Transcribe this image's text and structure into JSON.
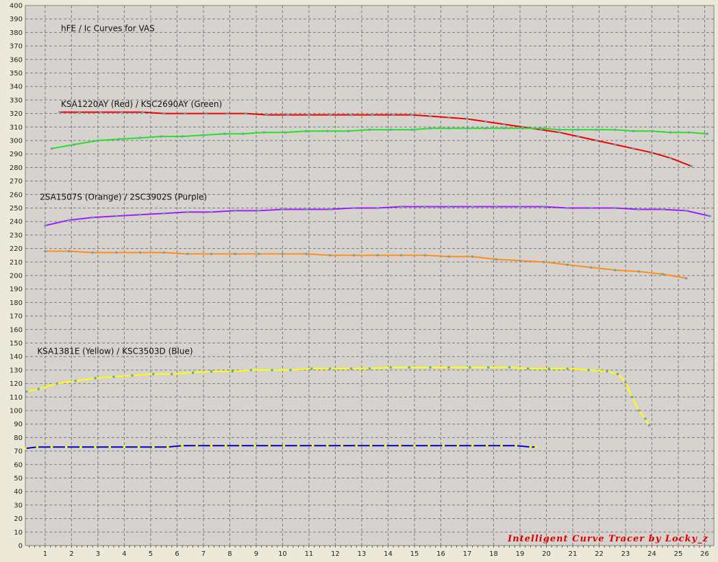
{
  "chart_data": {
    "type": "line",
    "title": "hFE / Ic Curves for VAS",
    "xlabel": "",
    "ylabel": "",
    "xlim": [
      0.25,
      26.35
    ],
    "ylim": [
      0,
      400
    ],
    "x_ticks": [
      1,
      2,
      3,
      4,
      5,
      6,
      7,
      8,
      9,
      10,
      11,
      12,
      13,
      14,
      15,
      16,
      17,
      18,
      19,
      20,
      21,
      22,
      23,
      24,
      25,
      26
    ],
    "x_tick_labels": [
      "1",
      "2",
      "3",
      "4",
      "5",
      "6",
      "7",
      "8",
      "9",
      "10",
      "11",
      "12",
      "13",
      "14",
      "15",
      "16",
      "17",
      "18",
      "19",
      "20",
      "21",
      "22",
      "23",
      "24",
      "25",
      "26"
    ],
    "y_ticks": [
      0,
      10,
      20,
      30,
      40,
      50,
      60,
      70,
      80,
      90,
      100,
      110,
      120,
      130,
      140,
      150,
      160,
      170,
      180,
      190,
      200,
      210,
      220,
      230,
      240,
      250,
      260,
      270,
      280,
      290,
      300,
      310,
      320,
      330,
      340,
      350,
      360,
      370,
      380,
      390,
      400
    ],
    "y_tick_labels": [
      "0",
      "10",
      "20",
      "30",
      "40",
      "50",
      "60",
      "70",
      "80",
      "90",
      "100",
      "110",
      "120",
      "130",
      "140",
      "150",
      "160",
      "170",
      "180",
      "190",
      "200",
      "210",
      "220",
      "230",
      "240",
      "250",
      "260",
      "270",
      "280",
      "290",
      "300",
      "310",
      "320",
      "330",
      "340",
      "350",
      "360",
      "370",
      "380",
      "390",
      "400"
    ],
    "grid": true,
    "annotations": [
      {
        "text": "hFE / Ic Curves for VAS",
        "x": 1.6,
        "y": 381
      },
      {
        "text": "KSA1220AY (Red) / KSC2690AY (Green)",
        "x": 1.6,
        "y": 325
      },
      {
        "text": "2SA1507S (Orange) / 2SC3902S (Purple)",
        "x": 0.8,
        "y": 256
      },
      {
        "text": "KSA1381E (Yellow) / KSC3503D (Blue)",
        "x": 0.7,
        "y": 142
      }
    ],
    "watermark": "Intelligent Curve Tracer by Locky_z",
    "series": [
      {
        "name": "KSA1220AY (Red)",
        "color": "#ee0000",
        "marker_color": "#77a0a8",
        "x": [
          1.55,
          2.3,
          3.1,
          3.9,
          4.7,
          5.5,
          6.3,
          7.1,
          7.9,
          8.6,
          9.4,
          10.2,
          11.0,
          11.8,
          12.6,
          13.4,
          14.2,
          14.9,
          15.6,
          16.3,
          17.0,
          17.7,
          18.4,
          19.1,
          19.8,
          20.5,
          21.2,
          21.9,
          22.6,
          23.3,
          24.0,
          24.7,
          25.5
        ],
        "y": [
          321,
          321,
          321,
          321,
          321,
          320,
          320,
          320,
          320,
          320,
          319,
          319,
          319,
          319,
          319,
          319,
          319,
          319,
          318,
          317,
          316,
          314,
          312,
          310,
          308,
          306,
          303,
          300,
          297,
          294,
          291,
          287,
          281
        ]
      },
      {
        "name": "KSC2690AY (Green)",
        "color": "#22e022",
        "marker_color": "#77a0a8",
        "x": [
          1.25,
          2.1,
          3.0,
          3.8,
          4.6,
          5.4,
          6.2,
          7.0,
          7.8,
          8.5,
          9.3,
          10.1,
          10.9,
          11.7,
          12.5,
          13.3,
          14.1,
          14.9,
          15.6,
          16.3,
          17.0,
          17.7,
          18.4,
          19.1,
          19.8,
          20.5,
          21.2,
          21.9,
          22.6,
          23.3,
          24.0,
          24.7,
          25.4,
          26.1
        ],
        "y": [
          294,
          297,
          300,
          301,
          302,
          303,
          303,
          304,
          305,
          305,
          306,
          306,
          307,
          307,
          307,
          308,
          308,
          308,
          309,
          309,
          309,
          309,
          309,
          309,
          309,
          308,
          308,
          308,
          308,
          307,
          307,
          306,
          306,
          305
        ]
      },
      {
        "name": "2SC3902S (Purple)",
        "color": "#9b1eff",
        "marker_color": "#77a0a8",
        "x": [
          1.0,
          1.9,
          2.8,
          3.7,
          4.6,
          5.5,
          6.4,
          7.3,
          8.2,
          9.1,
          10.0,
          10.9,
          11.8,
          12.7,
          13.6,
          14.5,
          15.4,
          16.3,
          17.2,
          18.1,
          19.0,
          19.9,
          20.8,
          21.7,
          22.6,
          23.5,
          24.4,
          25.3,
          26.2
        ],
        "y": [
          237,
          241,
          243,
          244,
          245,
          246,
          247,
          247,
          248,
          248,
          249,
          249,
          249,
          250,
          250,
          251,
          251,
          251,
          251,
          251,
          251,
          251,
          250,
          250,
          250,
          249,
          249,
          248,
          244
        ]
      },
      {
        "name": "2SA1507S (Orange)",
        "color": "#ff8c1a",
        "marker_color": "#77a0a8",
        "x": [
          1.0,
          1.9,
          2.8,
          3.7,
          4.6,
          5.5,
          6.4,
          7.3,
          8.2,
          9.1,
          10.0,
          10.9,
          11.8,
          12.7,
          13.6,
          14.5,
          15.4,
          16.3,
          17.2,
          18.1,
          19.0,
          19.9,
          20.8,
          21.7,
          22.6,
          23.5,
          24.4,
          25.3
        ],
        "y": [
          218,
          218,
          217,
          217,
          217,
          217,
          216,
          216,
          216,
          216,
          216,
          216,
          215,
          215,
          215,
          215,
          215,
          214,
          214,
          212,
          211,
          210,
          208,
          206,
          204,
          203,
          201,
          198
        ]
      },
      {
        "name": "KSA1381E (Yellow)",
        "color": "#ffff00",
        "marker_color": "#77a0a8",
        "x": [
          0.3,
          0.75,
          1.45,
          2.15,
          2.9,
          3.6,
          4.3,
          5.1,
          5.8,
          6.6,
          7.3,
          8.1,
          8.8,
          9.6,
          10.3,
          11.1,
          11.8,
          12.6,
          13.3,
          14.1,
          14.8,
          15.6,
          16.3,
          17.1,
          17.8,
          18.6,
          19.3,
          20.1,
          20.8,
          21.6,
          22.3,
          22.7,
          23.0,
          23.25,
          23.5,
          23.75,
          23.9
        ],
        "y": [
          114,
          116,
          120,
          122,
          124,
          125,
          126,
          127,
          127,
          128,
          129,
          129,
          130,
          130,
          130,
          131,
          131,
          131,
          131,
          132,
          132,
          132,
          132,
          132,
          132,
          132,
          131,
          131,
          131,
          130,
          129,
          127,
          121,
          110,
          100,
          94,
          89
        ]
      },
      {
        "name": "KSC3503D (Blue)",
        "color": "#0000cc",
        "marker_color": "#ffff00",
        "x": [
          0.25,
          0.7,
          1.25,
          1.8,
          2.35,
          2.9,
          3.45,
          4.0,
          4.55,
          5.1,
          5.65,
          6.2,
          6.75,
          7.3,
          7.85,
          8.4,
          8.95,
          9.5,
          10.05,
          10.6,
          11.15,
          11.7,
          12.25,
          12.8,
          13.35,
          13.9,
          14.45,
          15.0,
          15.55,
          16.1,
          16.65,
          17.2,
          17.75,
          18.3,
          18.85,
          19.4,
          19.6
        ],
        "y": [
          72,
          73,
          73,
          73,
          73,
          73,
          73,
          73,
          73,
          73,
          73,
          74,
          74,
          74,
          74,
          74,
          74,
          74,
          74,
          74,
          74,
          74,
          74,
          74,
          74,
          74,
          74,
          74,
          74,
          74,
          74,
          74,
          74,
          74,
          74,
          73,
          73
        ]
      }
    ]
  }
}
